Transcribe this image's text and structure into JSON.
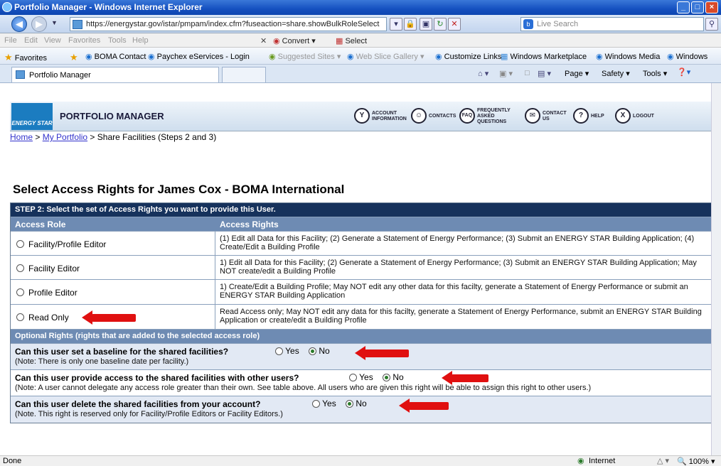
{
  "window": {
    "title": "Portfolio Manager - Windows Internet Explorer",
    "controls": [
      "_",
      "□",
      "×"
    ]
  },
  "address": {
    "url": "https://energystar.gov/istar/pmpam/index.cfm?fuseaction=share.showBulkRoleSelect",
    "search_placeholder": "Live Search"
  },
  "menu": {
    "items": [
      "File",
      "Edit",
      "View",
      "Favorites",
      "Tools",
      "Help"
    ],
    "convert": "Convert",
    "select": "Select"
  },
  "favorites": {
    "label": "Favorites",
    "links": [
      "BOMA Contact",
      "Paychex eServices - Login",
      "Suggested Sites ▾",
      "Web Slice Gallery ▾",
      "Customize Links",
      "Windows Marketplace",
      "Windows Media",
      "Windows"
    ]
  },
  "tabs": {
    "active": "Portfolio Manager",
    "tools": [
      "Page ▾",
      "Safety ▾",
      "Tools ▾"
    ]
  },
  "header": {
    "logo_text": "ENERGY STAR",
    "title": "PORTFOLIO MANAGER",
    "nav": [
      {
        "label": "ACCOUNT INFORMATION",
        "icon": "Y"
      },
      {
        "label": "CONTACTS",
        "icon": "☺"
      },
      {
        "label": "FREQUENTLY ASKED QUESTIONS",
        "icon": "FAQ"
      },
      {
        "label": "CONTACT US",
        "icon": "✉"
      },
      {
        "label": "HELP",
        "icon": "?"
      },
      {
        "label": "LOGOUT",
        "icon": "X"
      }
    ]
  },
  "breadcrumb": {
    "home": "Home",
    "portfolio": "My Portfolio",
    "sep": ">",
    "current": "Share Facilities (Steps 2 and 3)"
  },
  "page": {
    "heading": "Select Access Rights for James Cox - BOMA International"
  },
  "step2": {
    "title": "STEP 2: Select the set of Access Rights you want to provide this User.",
    "col_role": "Access Role",
    "col_rights": "Access Rights",
    "roles": [
      {
        "name": "Facility/Profile Editor",
        "rights": "(1) Edit all Data for this Facility; (2) Generate a Statement of Energy Performance; (3) Submit an ENERGY STAR Building Application; (4) Create/Edit a Building Profile"
      },
      {
        "name": "Facility Editor",
        "rights": "1) Edit all Data for this Facility; (2) Generate a Statement of Energy Performance; (3) Submit an ENERGY STAR Building Application; May NOT create/edit a Building Profile"
      },
      {
        "name": "Profile Editor",
        "rights": "1) Create/Edit a Building Profile; May NOT edit any other data for this facilty, generate a Statement of Energy Performance or submit an ENERGY STAR Building Application"
      },
      {
        "name": "Read Only",
        "rights": "Read Access only; May NOT edit any data for this facilty, generate a Statement of Energy Performance, submit an ENERGY STAR Building Application or create/edit a Building Profile"
      }
    ]
  },
  "optional": {
    "title": "Optional Rights (rights that are added to the selected access role)",
    "yes": "Yes",
    "no": "No",
    "questions": [
      {
        "q": "Can this user set a baseline for the shared facilities?",
        "note": "(Note: There is only one baseline date per facility.)",
        "selected": "No"
      },
      {
        "q": "Can this user provide access to the shared facilities with other users?",
        "note": "(Note: A user cannot delegate any access role greater than their own. See table above. All users who are given this right will be able to assign this right to other users.)",
        "selected": "No"
      },
      {
        "q": "Can this user delete the shared facilities from your account?",
        "note": "(Note. This right is reserved only for Facility/Profile Editors or Facility Editors.)",
        "selected": "No"
      }
    ]
  },
  "status": {
    "left": "Done",
    "zone": "Internet",
    "zoom": "100%"
  },
  "colors": {
    "dark_header": "#16325c",
    "col_header": "#6e8bb3",
    "annotation_arrow": "#e01010"
  }
}
